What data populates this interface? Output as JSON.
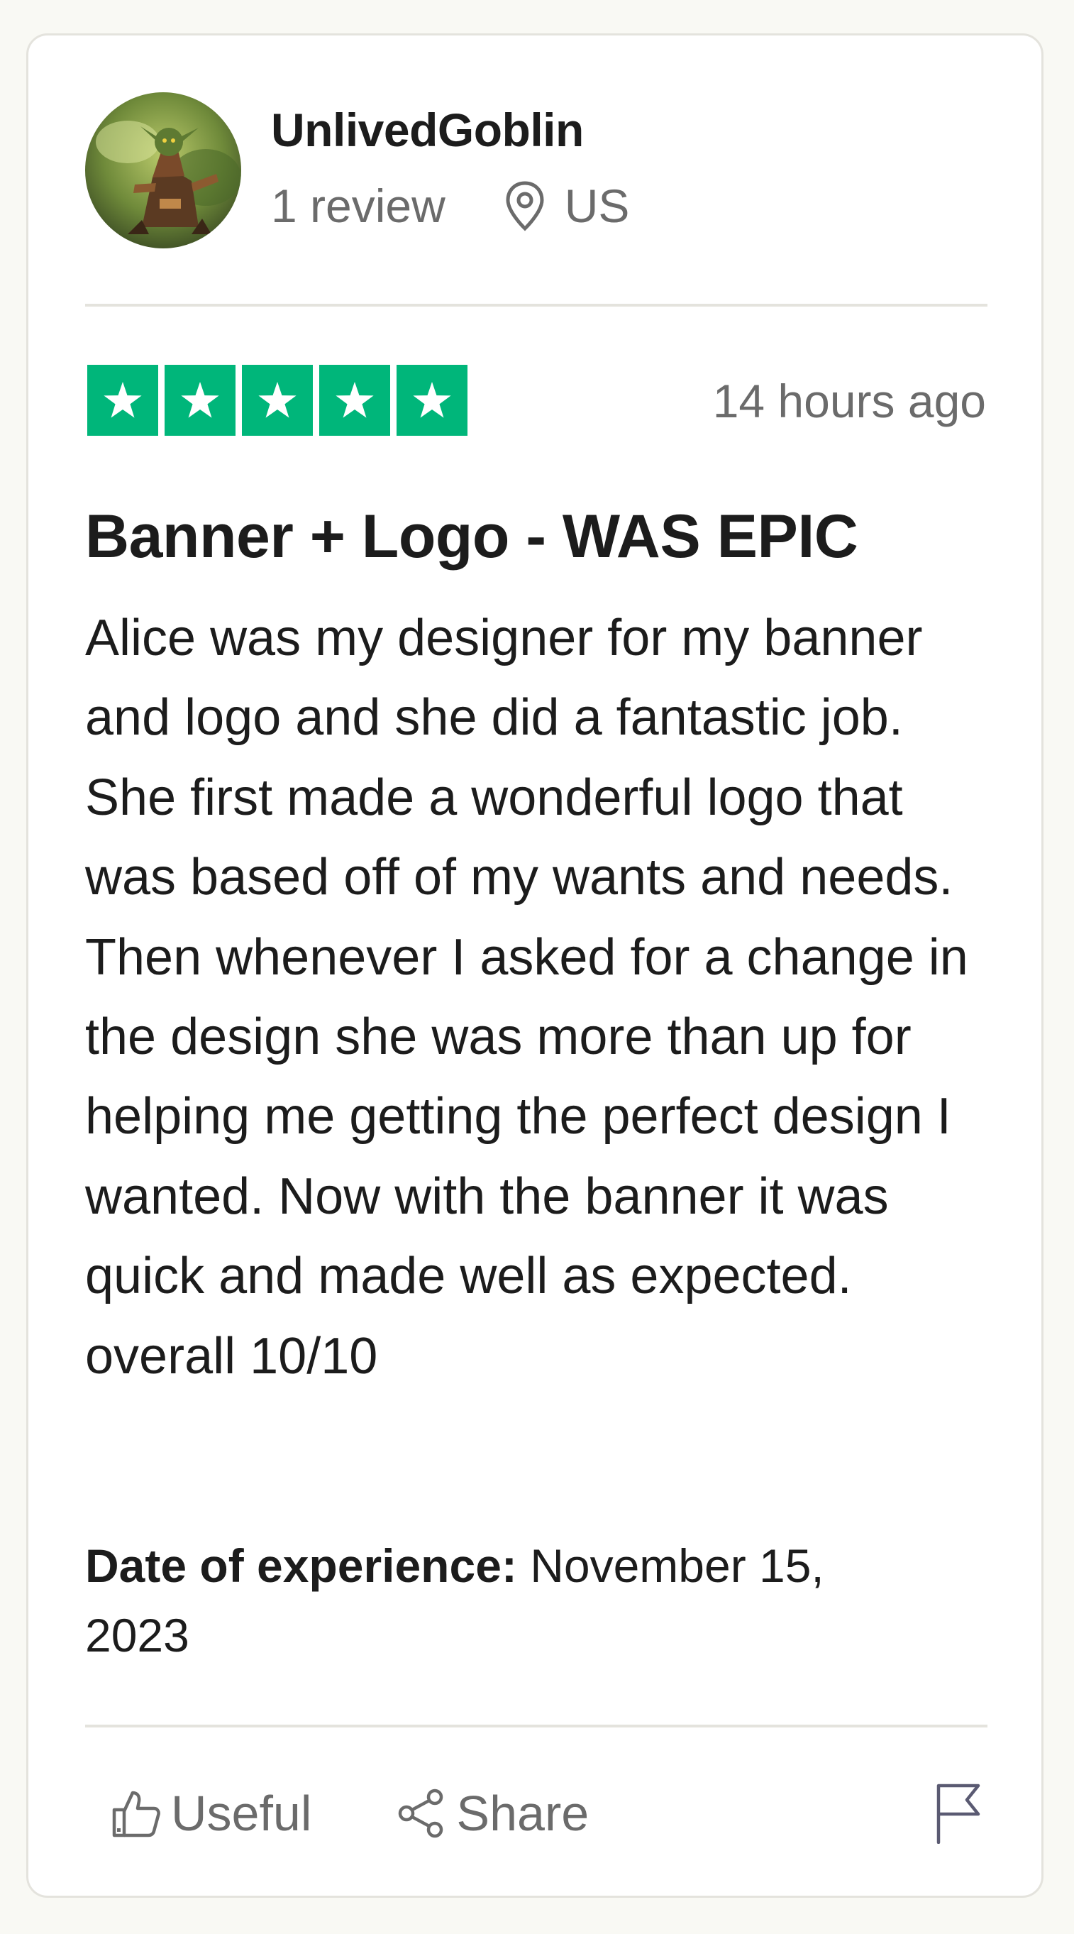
{
  "reviewer": {
    "name": "UnlivedGoblin",
    "review_count": "1 review",
    "country": "US"
  },
  "review": {
    "rating": 5,
    "rating_max": 5,
    "star_color": "#00b67a",
    "time_ago": "14 hours ago",
    "title": "Banner + Logo - WAS EPIC",
    "body": "Alice was my designer for my banner and logo and she did a fantastic job. She first made a wonderful logo that was based off of my wants and needs. Then whenever I asked for a change in the design she was more than up for helping me getting the perfect design I wanted. Now with the banner it was quick and made well as expected. overall 10/10",
    "experience_label": "Date of experience:",
    "experience_date": "November 15, 2023"
  },
  "actions": {
    "useful_label": "Useful",
    "share_label": "Share"
  },
  "icons": {
    "location": "location-pin-icon",
    "useful": "thumbs-up-icon",
    "share": "share-icon",
    "report": "flag-icon"
  }
}
